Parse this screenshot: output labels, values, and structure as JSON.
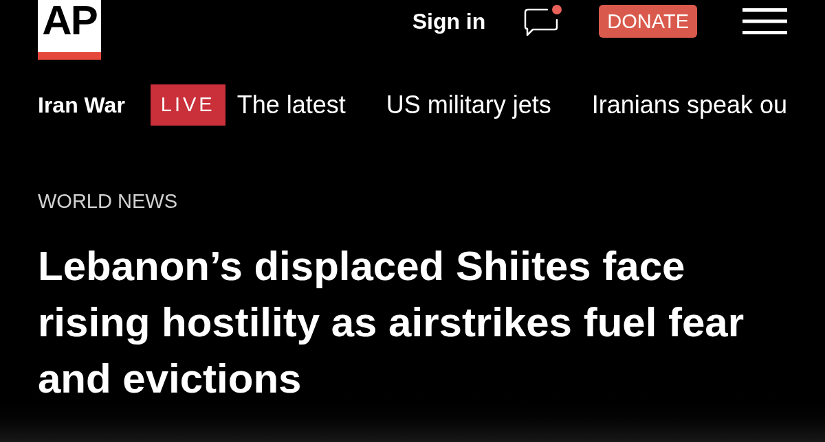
{
  "header": {
    "logo": "AP",
    "sign_in": "Sign in",
    "chat_unread": true,
    "donate_button": "DONATE"
  },
  "nav": {
    "section": "Iran War",
    "live_badge": "LIVE",
    "links": [
      "The latest",
      "US military jets",
      "Iranians speak ou"
    ]
  },
  "article": {
    "category": "WORLD NEWS",
    "headline": "Lebanon’s displaced Shiites face rising hostility as airstrikes fuel fear and evictions"
  }
}
